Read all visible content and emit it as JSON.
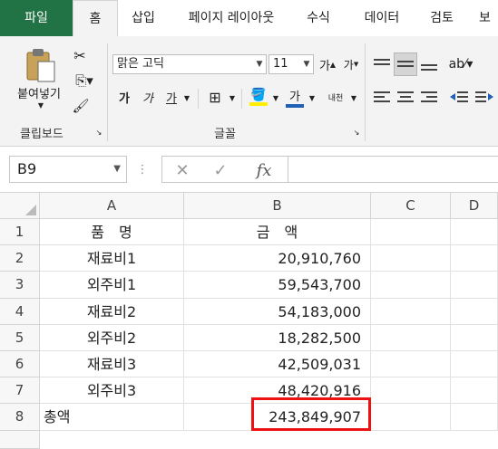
{
  "tabs": [
    "파일",
    "홈",
    "삽입",
    "페이지 레이아웃",
    "수식",
    "데이터",
    "검토",
    "보"
  ],
  "ribbon": {
    "paste_label": "붙여넣기",
    "clipboard_label": "클립보드",
    "font_group_label": "글꼴",
    "font_name": "맑은 고딕",
    "font_size": "11",
    "grow_font": "가",
    "shrink_font": "가",
    "bold": "가",
    "italic": "가",
    "underline": "가",
    "font_color_glyph": "가",
    "phonetic": "내천"
  },
  "formula_bar": {
    "name_box": "B9",
    "fx": "fx",
    "value": ""
  },
  "grid": {
    "columns": [
      "A",
      "B",
      "C",
      "D"
    ],
    "rows": [
      {
        "num": "1",
        "a": "품　명",
        "b": "금　액"
      },
      {
        "num": "2",
        "a": "재료비1",
        "b": "20,910,760"
      },
      {
        "num": "3",
        "a": "외주비1",
        "b": "59,543,700"
      },
      {
        "num": "4",
        "a": "재료비2",
        "b": "54,183,000"
      },
      {
        "num": "5",
        "a": "외주비2",
        "b": "18,282,500"
      },
      {
        "num": "6",
        "a": "재료비3",
        "b": "42,509,031"
      },
      {
        "num": "7",
        "a": "외주비3",
        "b": "48,420,916"
      },
      {
        "num": "8",
        "a": "총액",
        "b": "243,849,907"
      }
    ]
  },
  "colors": {
    "file_tab": "#217346",
    "highlight_border": "#e11111",
    "frame_border": "#2ecc40"
  }
}
